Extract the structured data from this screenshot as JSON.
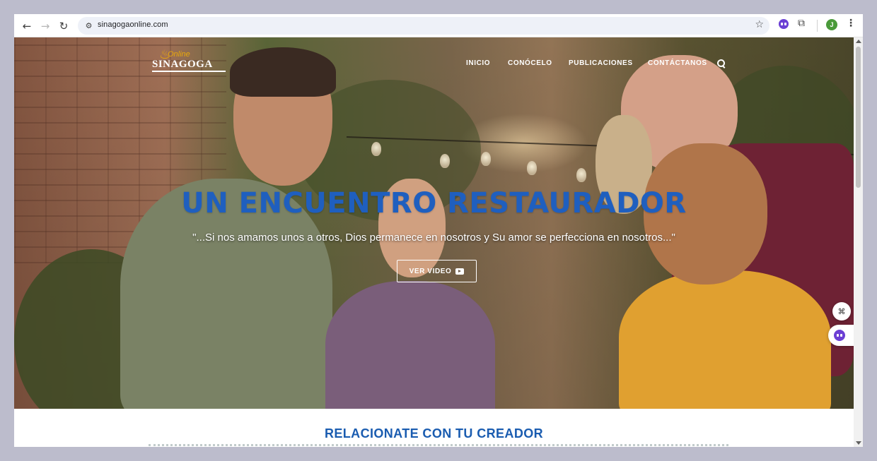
{
  "browser": {
    "url": "sinagogaonline.com",
    "profile_initial": "J"
  },
  "site": {
    "logo": {
      "online": "Online",
      "name": "SINAGOGA"
    },
    "nav": [
      "INICIO",
      "CONÓCELO",
      "PUBLICACIONES",
      "CONTÁCTANOS"
    ],
    "hero": {
      "title": "UN ENCUENTRO RESTAURADOR",
      "quote": "\"...Si nos amamos unos a otros, Dios permanece en nosotros y Su amor se perfecciona en nosotros...\"",
      "button": "VER VIDEO"
    },
    "section_title": "RELACIONATE CON TU CREADOR"
  },
  "colors": {
    "title_blue": "#1f5fbf",
    "section_blue": "#1a5cb0",
    "logo_gold": "#e8a80c",
    "extension_purple": "#6b3fd4"
  }
}
